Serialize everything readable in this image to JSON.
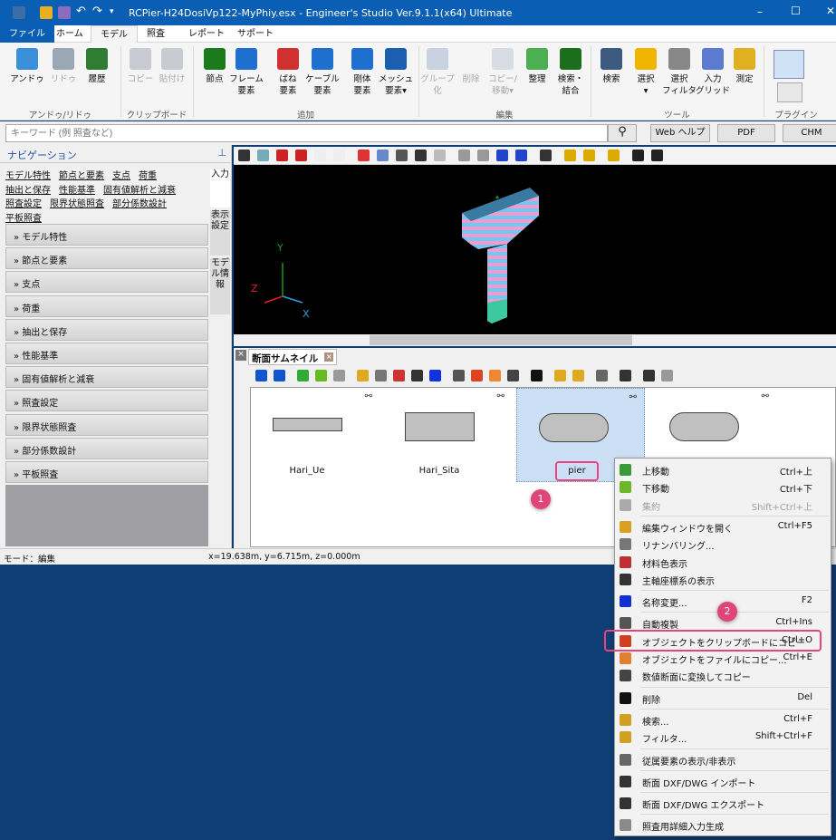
{
  "window": {
    "title": "RCPier-H24DosiVp122-MyPhiy.esx - Engineer's Studio Ver.9.1.1(x64) Ultimate",
    "min": "–",
    "max": "☐",
    "close": "✕"
  },
  "tabs": [
    "ファイル",
    "ホーム",
    "モデル",
    "照査",
    "レポート",
    "サポート"
  ],
  "ribbon": {
    "buttons": [
      {
        "label": "アンドゥ",
        "icon": "undo-icon",
        "color": "#3a8fd8",
        "disabled": false
      },
      {
        "label": "リドゥ",
        "icon": "redo-icon",
        "color": "#9aa7b5",
        "disabled": true
      },
      {
        "label": "履歴",
        "icon": "history-icon",
        "color": "#2e7d32",
        "disabled": false
      },
      {
        "label": "コピー",
        "icon": "copy-icon",
        "color": "#c8ccd2",
        "disabled": true
      },
      {
        "label": "貼付け",
        "icon": "paste-icon",
        "color": "#c8ccd2",
        "disabled": true
      },
      {
        "label": "節点",
        "icon": "node-icon",
        "color": "#1b7a1b",
        "disabled": false
      },
      {
        "label": "フレーム\n要素",
        "icon": "frame-element-icon",
        "color": "#1f6fcf",
        "disabled": false
      },
      {
        "label": "ばね\n要素",
        "icon": "spring-element-icon",
        "color": "#d03030",
        "disabled": false
      },
      {
        "label": "ケーブル\n要素",
        "icon": "cable-element-icon",
        "color": "#1f6fcf",
        "disabled": false
      },
      {
        "label": "剛体\n要素",
        "icon": "rigid-element-icon",
        "color": "#1f6fcf",
        "disabled": false
      },
      {
        "label": "メッシュ\n要素▾",
        "icon": "mesh-element-icon",
        "color": "#1a5fb0",
        "disabled": false
      },
      {
        "label": "グループ\n化",
        "icon": "group-icon",
        "color": "#c8d2e0",
        "disabled": true
      },
      {
        "label": "削除",
        "icon": "delete-icon",
        "color": "#f5f5f5",
        "disabled": true
      },
      {
        "label": "コピー/\n移動▾",
        "icon": "copy-move-icon",
        "color": "#d8dde4",
        "disabled": true
      },
      {
        "label": "整理",
        "icon": "recycle-icon",
        "color": "#4caf50",
        "disabled": false
      },
      {
        "label": "検索・\n結合",
        "icon": "search-merge-icon",
        "color": "#1b6e1b",
        "disabled": false
      },
      {
        "label": "検索",
        "icon": "binoculars-icon",
        "color": "#3d5a80",
        "disabled": false
      },
      {
        "label": "選択\n▾",
        "icon": "select-icon",
        "color": "#f0b400",
        "disabled": false
      },
      {
        "label": "選択\nフィルタ",
        "icon": "select-filter-icon",
        "color": "#888",
        "disabled": false
      },
      {
        "label": "入力\nグリッド",
        "icon": "input-grid-icon",
        "color": "#5a7bd0",
        "disabled": false
      },
      {
        "label": "測定",
        "icon": "measure-icon",
        "color": "#e0b020",
        "disabled": false
      }
    ],
    "groups": [
      "アンドゥ/リドゥ",
      "クリップボード",
      "追加",
      "編集",
      "ツール",
      "プラグイン"
    ]
  },
  "search": {
    "placeholder": "キーワード (例 照査など)",
    "web_help": "Web ヘルプ",
    "pdf": "PDF",
    "chm": "CHM"
  },
  "navigation": {
    "title": "ナビゲーション",
    "links": [
      "モデル特性",
      "節点と要素",
      "支点",
      "荷重",
      "抽出と保存",
      "性能基準",
      "固有値解析と減衰",
      "照査設定",
      "限界状態照査",
      "部分係数設計",
      "平板照査"
    ],
    "sections": [
      "モデル特性",
      "節点と要素",
      "支点",
      "荷重",
      "抽出と保存",
      "性能基準",
      "固有値解析と減衰",
      "照査設定",
      "限界状態照査",
      "部分係数設計",
      "平板照査"
    ],
    "side_tabs": [
      "入力",
      "表示設定",
      "モデル情報"
    ]
  },
  "view3d": {
    "axes": {
      "x": "X",
      "y": "Y",
      "z": "Z"
    }
  },
  "thumbnail_panel": {
    "tab": "断面サムネイル",
    "items": [
      {
        "name": "Hari_Ue",
        "shape": "rect-thin"
      },
      {
        "name": "Hari_Sita",
        "shape": "rect"
      },
      {
        "name": "pier",
        "shape": "oval",
        "selected": true
      },
      {
        "name": "",
        "shape": "oval"
      }
    ]
  },
  "status": {
    "mode": "モード：編集",
    "coords": "x=19.638m, y=6.715m, z=0.000m"
  },
  "context_menu": {
    "items": [
      {
        "label": "上移動",
        "shortcut": "Ctrl+上",
        "icon": "move-up-icon",
        "color": "#3a9a3a"
      },
      {
        "label": "下移動",
        "shortcut": "Ctrl+下",
        "icon": "move-down-icon",
        "color": "#6ab82a"
      },
      {
        "label": "集約",
        "shortcut": "Shift+Ctrl+上",
        "icon": "aggregate-icon",
        "color": "#aaa",
        "disabled": true
      },
      {
        "sep": true
      },
      {
        "label": "編集ウィンドウを開く",
        "shortcut": "Ctrl+F5",
        "icon": "edit-window-icon",
        "color": "#d8a020"
      },
      {
        "label": "リナンバリング...",
        "shortcut": "",
        "icon": "renumber-icon",
        "color": "#777"
      },
      {
        "label": "材料色表示",
        "shortcut": "",
        "icon": "material-color-icon",
        "color": "#c03030"
      },
      {
        "label": "主軸座標系の表示",
        "shortcut": "",
        "icon": "principal-axis-icon",
        "color": "#333"
      },
      {
        "sep": true
      },
      {
        "label": "名称変更...",
        "shortcut": "F2",
        "icon": "rename-icon",
        "color": "#1030d0"
      },
      {
        "sep": true
      },
      {
        "label": "自動複製",
        "shortcut": "Ctrl+Ins",
        "icon": "auto-duplicate-icon",
        "color": "#555"
      },
      {
        "label": "オブジェクトをクリップボードにコピー",
        "shortcut": "Ctrl+O",
        "icon": "clipboard-copy-icon",
        "color": "#d04020",
        "highlighted": true
      },
      {
        "label": "オブジェクトをファイルにコピー...",
        "shortcut": "Ctrl+E",
        "icon": "file-copy-icon",
        "color": "#e08030"
      },
      {
        "label": "数値断面に変換してコピー",
        "shortcut": "",
        "icon": "numeric-section-icon",
        "color": "#444"
      },
      {
        "sep": true
      },
      {
        "label": "削除",
        "shortcut": "Del",
        "icon": "delete-icon",
        "color": "#111"
      },
      {
        "sep": true
      },
      {
        "label": "検索...",
        "shortcut": "Ctrl+F",
        "icon": "search-icon",
        "color": "#d0a020"
      },
      {
        "label": "フィルタ...",
        "shortcut": "Shift+Ctrl+F",
        "icon": "filter-icon",
        "color": "#d0a020"
      },
      {
        "sep": true
      },
      {
        "label": "従属要素の表示/非表示",
        "shortcut": "",
        "icon": "dependent-toggle-icon",
        "color": "#666"
      },
      {
        "sep": true
      },
      {
        "label": "断面 DXF/DWG インポート",
        "shortcut": "",
        "icon": "dxf-import-icon",
        "color": "#333"
      },
      {
        "sep": true
      },
      {
        "label": "断面 DXF/DWG エクスポート",
        "shortcut": "",
        "icon": "dxf-export-icon",
        "color": "#333"
      },
      {
        "sep": true
      },
      {
        "label": "照査用詳細入力生成",
        "shortcut": "",
        "icon": "detail-input-icon",
        "color": "#8a8a8a"
      }
    ]
  },
  "annotations": [
    "1",
    "2"
  ],
  "colors": {
    "title_bar": "#0a5fb4",
    "desktop": "#0f3e75",
    "highlight": "#e8457a",
    "selection": "#cce0f5"
  }
}
